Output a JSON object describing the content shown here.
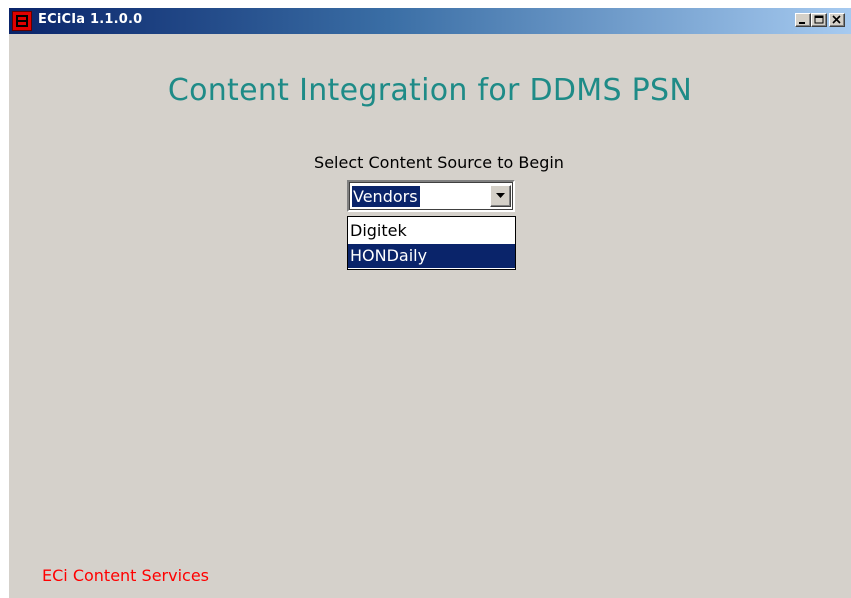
{
  "window": {
    "title": "ECiCIa 1.1.0.0",
    "controls": {
      "minimize_icon": "minimize-icon",
      "maximize_icon": "maximize-icon",
      "close_icon": "close-icon"
    }
  },
  "main": {
    "heading": "Content Integration for DDMS PSN",
    "prompt": "Select Content Source to Begin",
    "source_select": {
      "value": "Vendors",
      "options": [
        "Digitek",
        "HONDaily"
      ],
      "highlighted_option": "HONDaily"
    }
  },
  "footer": {
    "text": "ECi Content Services"
  },
  "colors": {
    "heading": "#1e8b87",
    "footer": "#ff0000",
    "selection": "#0a246a",
    "window_bg": "#d5d1cb",
    "app_icon": "#e00000"
  }
}
